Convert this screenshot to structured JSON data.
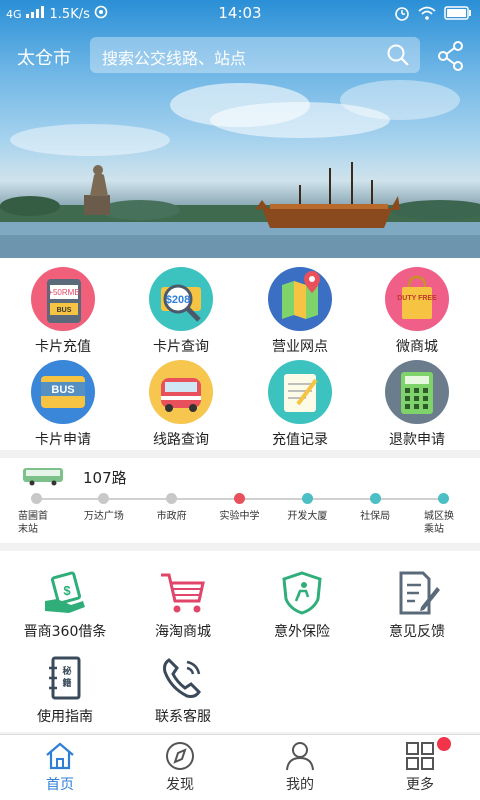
{
  "status_bar": {
    "network": "4G",
    "speed": "1.5K/s",
    "time": "14:03"
  },
  "header": {
    "city": "太仓市",
    "search_placeholder": "搜索公交线路、站点"
  },
  "card_grid": [
    {
      "label": "卡片充值",
      "icon": "card-topup-icon",
      "badge_text": "+50RMB",
      "sub_text": "BUS"
    },
    {
      "label": "卡片查询",
      "icon": "card-query-icon",
      "badge_text": "$208"
    },
    {
      "label": "营业网点",
      "icon": "map-outlet-icon"
    },
    {
      "label": "微商城",
      "icon": "shopping-bag-icon",
      "badge_text": "DUTY FREE"
    },
    {
      "label": "卡片申请",
      "icon": "bus-card-icon",
      "badge_text": "BUS"
    },
    {
      "label": "线路查询",
      "icon": "bus-route-icon"
    },
    {
      "label": "充值记录",
      "icon": "notebook-icon"
    },
    {
      "label": "退款申请",
      "icon": "calculator-icon"
    }
  ],
  "route": {
    "name": "107路",
    "stops": [
      "苗圃首末站",
      "万达广场",
      "市政府",
      "实验中学",
      "开发大厦",
      "社保局",
      "城区换乘站"
    ],
    "current_stop_index": 3,
    "colors": {
      "passed": "#c8c8c8",
      "current": "#e8505b",
      "upcoming": "#4bbfc4"
    }
  },
  "services": [
    {
      "label": "晋商360借条",
      "icon": "money-hand-icon"
    },
    {
      "label": "海淘商城",
      "icon": "shopping-cart-icon"
    },
    {
      "label": "意外保险",
      "icon": "insurance-shield-icon"
    },
    {
      "label": "意见反馈",
      "icon": "feedback-document-icon"
    },
    {
      "label": "使用指南",
      "icon": "guide-book-icon"
    },
    {
      "label": "联系客服",
      "icon": "phone-icon"
    }
  ],
  "bottom_nav": [
    {
      "label": "首页",
      "icon": "home-icon",
      "active": true
    },
    {
      "label": "发现",
      "icon": "compass-icon",
      "active": false
    },
    {
      "label": "我的",
      "icon": "user-icon",
      "active": false
    },
    {
      "label": "更多",
      "icon": "grid-icon",
      "active": false
    }
  ],
  "colors": {
    "accent": "#2f7fd8",
    "service_green": "#2fae7a",
    "service_pink": "#e0456a",
    "badge_red": "#f2344b"
  }
}
